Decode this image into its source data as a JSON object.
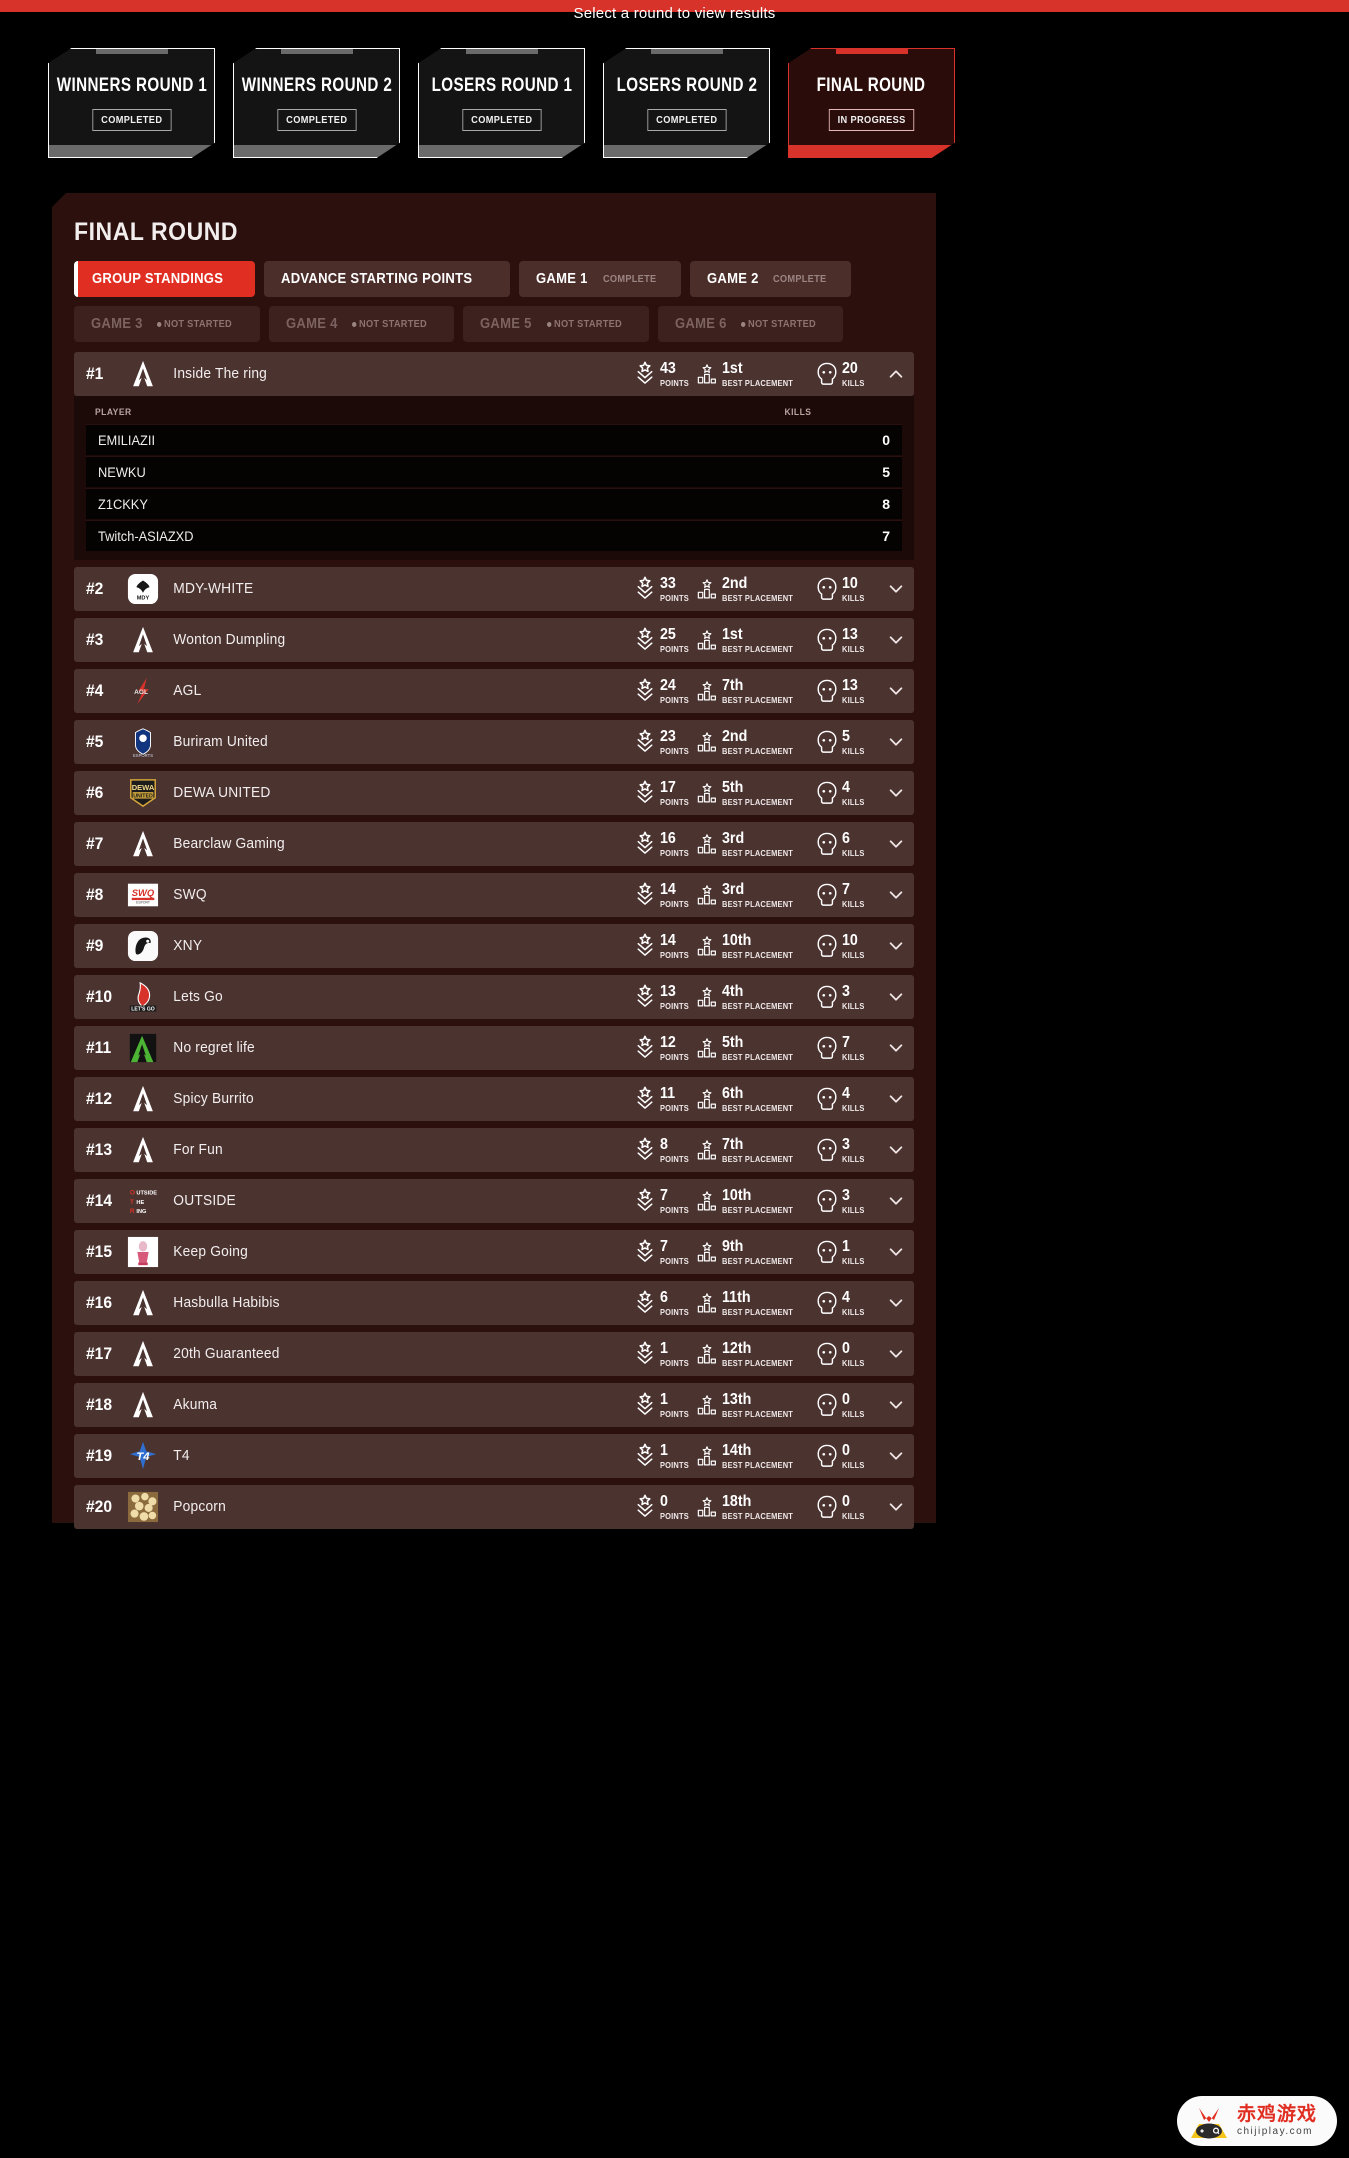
{
  "banner": {
    "caption": "Select a round to view results"
  },
  "rounds": [
    {
      "title": "WINNERS ROUND 1",
      "status": "COMPLETED",
      "active": false
    },
    {
      "title": "WINNERS ROUND 2",
      "status": "COMPLETED",
      "active": false
    },
    {
      "title": "LOSERS ROUND 1",
      "status": "COMPLETED",
      "active": false
    },
    {
      "title": "LOSERS ROUND 2",
      "status": "COMPLETED",
      "active": false
    },
    {
      "title": "FINAL ROUND",
      "status": "IN PROGRESS",
      "active": true
    }
  ],
  "panel": {
    "title": "FINAL ROUND"
  },
  "tabs": [
    {
      "label": "GROUP STANDINGS",
      "sub": "",
      "state": "active"
    },
    {
      "label": "ADVANCE STARTING POINTS",
      "sub": "",
      "state": "normal"
    },
    {
      "label": "GAME 1",
      "sub": "COMPLETE",
      "state": "normal"
    },
    {
      "label": "GAME 2",
      "sub": "COMPLETE",
      "state": "normal"
    },
    {
      "label": "GAME 3",
      "sub": "NOT STARTED",
      "state": "disabled"
    },
    {
      "label": "GAME 4",
      "sub": "NOT STARTED",
      "state": "disabled"
    },
    {
      "label": "GAME 5",
      "sub": "NOT STARTED",
      "state": "disabled"
    },
    {
      "label": "GAME 6",
      "sub": "NOT STARTED",
      "state": "disabled"
    }
  ],
  "stat_labels": {
    "points": "POINTS",
    "placement": "BEST PLACEMENT",
    "kills": "KILLS"
  },
  "players_table": {
    "player_header": "PLAYER",
    "kills_header": "KILLS"
  },
  "standings": [
    {
      "rank": "#1",
      "team": "Inside The ring",
      "points": "43",
      "placement": "1st",
      "kills": "20",
      "logo": "apex-icon",
      "expanded": true,
      "players": [
        {
          "name": "EMILIAZII",
          "kills": "0"
        },
        {
          "name": "NEWKU",
          "kills": "5"
        },
        {
          "name": "Z1CKKY",
          "kills": "8"
        },
        {
          "name": "Twitch-ASIAZXD",
          "kills": "7"
        }
      ]
    },
    {
      "rank": "#2",
      "team": "MDY-WHITE",
      "points": "33",
      "placement": "2nd",
      "kills": "10",
      "logo": "mdy-logo-icon",
      "expanded": false
    },
    {
      "rank": "#3",
      "team": "Wonton Dumpling",
      "points": "25",
      "placement": "1st",
      "kills": "13",
      "logo": "apex-icon",
      "expanded": false
    },
    {
      "rank": "#4",
      "team": "AGL",
      "points": "24",
      "placement": "7th",
      "kills": "13",
      "logo": "agl-logo-icon",
      "expanded": false
    },
    {
      "rank": "#5",
      "team": "Buriram United",
      "points": "23",
      "placement": "2nd",
      "kills": "5",
      "logo": "buriram-logo-icon",
      "expanded": false
    },
    {
      "rank": "#6",
      "team": "DEWA UNITED",
      "points": "17",
      "placement": "5th",
      "kills": "4",
      "logo": "dewa-logo-icon",
      "expanded": false
    },
    {
      "rank": "#7",
      "team": "Bearclaw Gaming",
      "points": "16",
      "placement": "3rd",
      "kills": "6",
      "logo": "apex-icon",
      "expanded": false
    },
    {
      "rank": "#8",
      "team": "SWQ",
      "points": "14",
      "placement": "3rd",
      "kills": "7",
      "logo": "swq-logo-icon",
      "expanded": false
    },
    {
      "rank": "#9",
      "team": "XNY",
      "points": "14",
      "placement": "10th",
      "kills": "10",
      "logo": "xny-logo-icon",
      "expanded": false
    },
    {
      "rank": "#10",
      "team": "Lets Go",
      "points": "13",
      "placement": "4th",
      "kills": "3",
      "logo": "letsgo-logo-icon",
      "expanded": false
    },
    {
      "rank": "#11",
      "team": "No regret life",
      "points": "12",
      "placement": "5th",
      "kills": "7",
      "logo": "noregret-logo-icon",
      "expanded": false
    },
    {
      "rank": "#12",
      "team": "Spicy Burrito",
      "points": "11",
      "placement": "6th",
      "kills": "4",
      "logo": "apex-icon",
      "expanded": false
    },
    {
      "rank": "#13",
      "team": "For Fun",
      "points": "8",
      "placement": "7th",
      "kills": "3",
      "logo": "apex-icon",
      "expanded": false
    },
    {
      "rank": "#14",
      "team": "OUTSIDE",
      "points": "7",
      "placement": "10th",
      "kills": "3",
      "logo": "outside-logo-icon",
      "expanded": false
    },
    {
      "rank": "#15",
      "team": "Keep Going",
      "points": "7",
      "placement": "9th",
      "kills": "1",
      "logo": "keepgoing-logo-icon",
      "expanded": false
    },
    {
      "rank": "#16",
      "team": "Hasbulla Habibis",
      "points": "6",
      "placement": "11th",
      "kills": "4",
      "logo": "apex-icon",
      "expanded": false
    },
    {
      "rank": "#17",
      "team": "20th Guaranteed",
      "points": "1",
      "placement": "12th",
      "kills": "0",
      "logo": "apex-icon",
      "expanded": false
    },
    {
      "rank": "#18",
      "team": "Akuma",
      "points": "1",
      "placement": "13th",
      "kills": "0",
      "logo": "apex-icon",
      "expanded": false
    },
    {
      "rank": "#19",
      "team": "T4",
      "points": "1",
      "placement": "14th",
      "kills": "0",
      "logo": "t4-logo-icon",
      "expanded": false
    },
    {
      "rank": "#20",
      "team": "Popcorn",
      "points": "0",
      "placement": "18th",
      "kills": "0",
      "logo": "popcorn-logo-icon",
      "expanded": false
    }
  ],
  "watermark": {
    "cn": "赤鸡游戏",
    "en": "chijiplay.com"
  },
  "colors": {
    "accent_red": "#d8332a",
    "tab_active": "#e02f22",
    "panel_bg": "#2c100d",
    "row_bg": "#4b3330",
    "page_bg": "#000000"
  }
}
